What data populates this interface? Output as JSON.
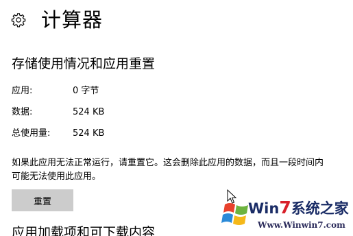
{
  "header": {
    "title": "计算器",
    "settings_icon": "gear-icon"
  },
  "storage": {
    "heading": "存储使用情况和应用重置",
    "rows": [
      {
        "label": "应用:",
        "value": "0 字节"
      },
      {
        "label": "数据:",
        "value": "524 KB"
      },
      {
        "label": "总使用量:",
        "value": "524 KB"
      }
    ],
    "description": "如果此应用无法正常运行，请重置它。这会删除此应用的数据，而且一段时间内可能无法使用此应用。",
    "reset_label": "重置"
  },
  "addons": {
    "heading": "应用加载项和可下载内容"
  },
  "watermark": {
    "brand_win": "Win",
    "brand_seven": "7",
    "brand_rest": "系统之家",
    "url": "Www.Winwin7.com",
    "logo_icon": "windows-logo-icon"
  },
  "colors": {
    "background": "#ffffff",
    "button": "#cccccc",
    "text": "#000000"
  }
}
